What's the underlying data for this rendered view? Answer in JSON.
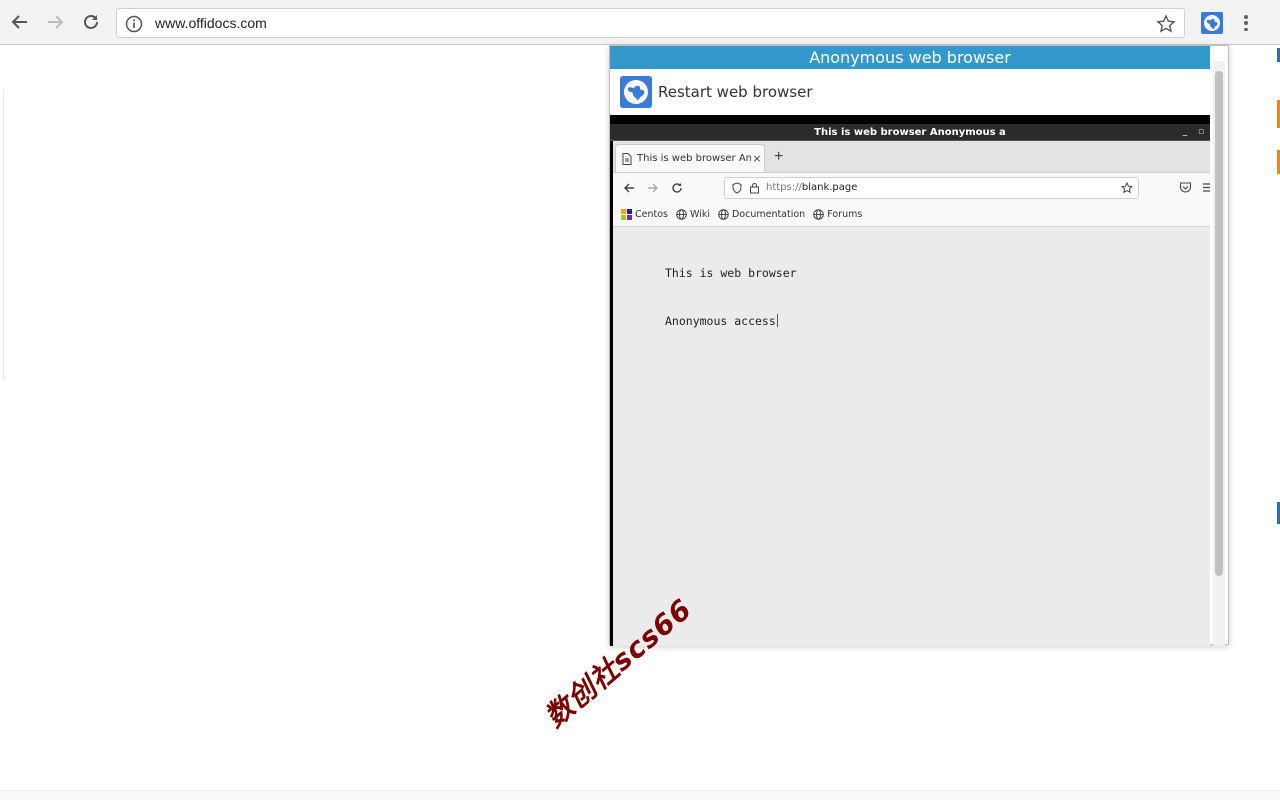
{
  "browser": {
    "url": "www.offidocs.com"
  },
  "popup": {
    "header_title": "Anonymous web browser",
    "restart_label": "Restart web browser"
  },
  "vm": {
    "window_title": "This is web browser Anonymous a",
    "tab_title": "This is web browser Anonymous",
    "url_scheme": "https://",
    "url_host": "blank.page",
    "bookmarks": [
      {
        "label": "Centos"
      },
      {
        "label": "Wiki"
      },
      {
        "label": "Documentation"
      },
      {
        "label": "Forums"
      }
    ],
    "content_line1": "This is web browser",
    "content_line2": "Anonymous access"
  },
  "colors": {
    "popup_header": "#3399cc",
    "watermark": "#7a0000"
  },
  "watermark_text": "数创社scs66"
}
